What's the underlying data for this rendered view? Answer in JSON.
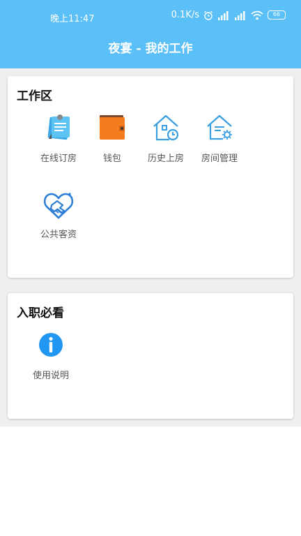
{
  "status_bar": {
    "time": "晚上11:47",
    "network_speed": "0.1K/s",
    "battery": "66"
  },
  "header": {
    "title": "夜宴 - 我的工作",
    "background_color": "#5bc0f8"
  },
  "work_section": {
    "title": "工作区",
    "items": [
      {
        "label": "在线订房",
        "icon": "online-booking-icon"
      },
      {
        "label": "钱包",
        "icon": "wallet-icon"
      },
      {
        "label": "历史上房",
        "icon": "history-house-icon"
      },
      {
        "label": "房间管理",
        "icon": "room-management-icon"
      },
      {
        "label": "公共客资",
        "icon": "handshake-icon"
      }
    ]
  },
  "onboarding_section": {
    "title": "入职必看",
    "items": [
      {
        "label": "使用说明",
        "icon": "info-icon"
      }
    ]
  }
}
